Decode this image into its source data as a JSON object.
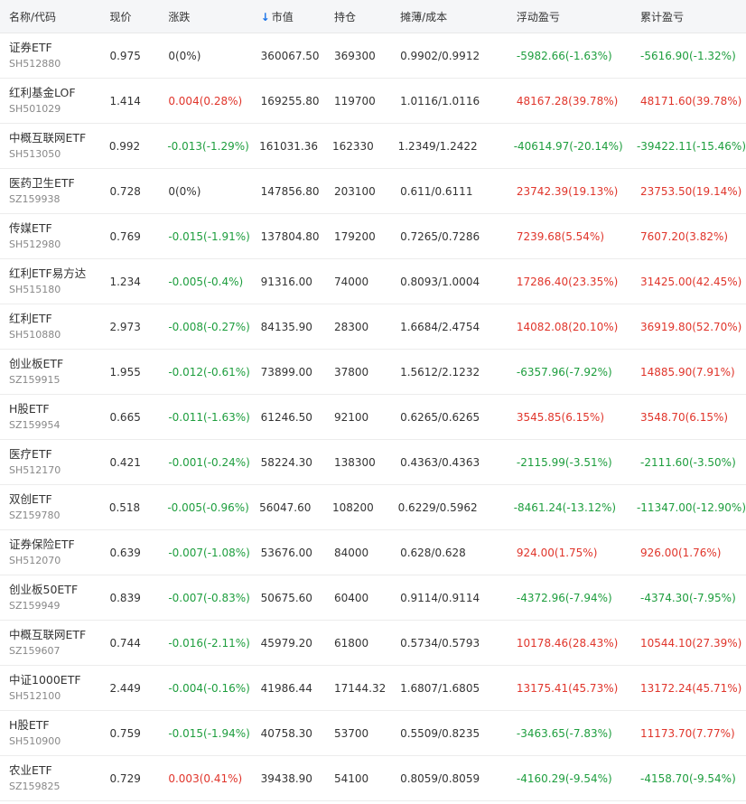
{
  "colors": {
    "up": "#e0352b",
    "down": "#1e9e3e",
    "sort_arrow": "#1a73e8"
  },
  "header": {
    "name": "名称/代码",
    "price": "现价",
    "change": "涨跌",
    "sort_arrow_icon": "arrow-down-icon",
    "value": "市值",
    "position": "持仓",
    "cost": "摊薄/成本",
    "float_pl": "浮动盈亏",
    "cum_pl": "累计盈亏"
  },
  "rows": [
    {
      "name": "证券ETF",
      "code": "SH512880",
      "price": "0.975",
      "change": "0(0%)",
      "change_dir": "flat",
      "value": "360067.50",
      "position": "369300",
      "cost": "0.9902/0.9912",
      "float_pl": "-5982.66(-1.63%)",
      "float_dir": "down",
      "cum_pl": "-5616.90(-1.32%)",
      "cum_dir": "down"
    },
    {
      "name": "红利基金LOF",
      "code": "SH501029",
      "price": "1.414",
      "change": "0.004(0.28%)",
      "change_dir": "up",
      "value": "169255.80",
      "position": "119700",
      "cost": "1.0116/1.0116",
      "float_pl": "48167.28(39.78%)",
      "float_dir": "up",
      "cum_pl": "48171.60(39.78%)",
      "cum_dir": "up"
    },
    {
      "name": "中概互联网ETF",
      "code": "SH513050",
      "price": "0.992",
      "change": "-0.013(-1.29%)",
      "change_dir": "down",
      "value": "161031.36",
      "position": "162330",
      "cost": "1.2349/1.2422",
      "float_pl": "-40614.97(-20.14%)",
      "float_dir": "down",
      "cum_pl": "-39422.11(-15.46%)",
      "cum_dir": "down"
    },
    {
      "name": "医药卫生ETF",
      "code": "SZ159938",
      "price": "0.728",
      "change": "0(0%)",
      "change_dir": "flat",
      "value": "147856.80",
      "position": "203100",
      "cost": "0.611/0.6111",
      "float_pl": "23742.39(19.13%)",
      "float_dir": "up",
      "cum_pl": "23753.50(19.14%)",
      "cum_dir": "up"
    },
    {
      "name": "传媒ETF",
      "code": "SH512980",
      "price": "0.769",
      "change": "-0.015(-1.91%)",
      "change_dir": "down",
      "value": "137804.80",
      "position": "179200",
      "cost": "0.7265/0.7286",
      "float_pl": "7239.68(5.54%)",
      "float_dir": "up",
      "cum_pl": "7607.20(3.82%)",
      "cum_dir": "up"
    },
    {
      "name": "红利ETF易方达",
      "code": "SH515180",
      "price": "1.234",
      "change": "-0.005(-0.4%)",
      "change_dir": "down",
      "value": "91316.00",
      "position": "74000",
      "cost": "0.8093/1.0004",
      "float_pl": "17286.40(23.35%)",
      "float_dir": "up",
      "cum_pl": "31425.00(42.45%)",
      "cum_dir": "up"
    },
    {
      "name": "红利ETF",
      "code": "SH510880",
      "price": "2.973",
      "change": "-0.008(-0.27%)",
      "change_dir": "down",
      "value": "84135.90",
      "position": "28300",
      "cost": "1.6684/2.4754",
      "float_pl": "14082.08(20.10%)",
      "float_dir": "up",
      "cum_pl": "36919.80(52.70%)",
      "cum_dir": "up"
    },
    {
      "name": "创业板ETF",
      "code": "SZ159915",
      "price": "1.955",
      "change": "-0.012(-0.61%)",
      "change_dir": "down",
      "value": "73899.00",
      "position": "37800",
      "cost": "1.5612/2.1232",
      "float_pl": "-6357.96(-7.92%)",
      "float_dir": "down",
      "cum_pl": "14885.90(7.91%)",
      "cum_dir": "up"
    },
    {
      "name": "H股ETF",
      "code": "SZ159954",
      "price": "0.665",
      "change": "-0.011(-1.63%)",
      "change_dir": "down",
      "value": "61246.50",
      "position": "92100",
      "cost": "0.6265/0.6265",
      "float_pl": "3545.85(6.15%)",
      "float_dir": "up",
      "cum_pl": "3548.70(6.15%)",
      "cum_dir": "up"
    },
    {
      "name": "医疗ETF",
      "code": "SH512170",
      "price": "0.421",
      "change": "-0.001(-0.24%)",
      "change_dir": "down",
      "value": "58224.30",
      "position": "138300",
      "cost": "0.4363/0.4363",
      "float_pl": "-2115.99(-3.51%)",
      "float_dir": "down",
      "cum_pl": "-2111.60(-3.50%)",
      "cum_dir": "down"
    },
    {
      "name": "双创ETF",
      "code": "SZ159780",
      "price": "0.518",
      "change": "-0.005(-0.96%)",
      "change_dir": "down",
      "value": "56047.60",
      "position": "108200",
      "cost": "0.6229/0.5962",
      "float_pl": "-8461.24(-13.12%)",
      "float_dir": "down",
      "cum_pl": "-11347.00(-12.90%)",
      "cum_dir": "down"
    },
    {
      "name": "证券保险ETF",
      "code": "SH512070",
      "price": "0.639",
      "change": "-0.007(-1.08%)",
      "change_dir": "down",
      "value": "53676.00",
      "position": "84000",
      "cost": "0.628/0.628",
      "float_pl": "924.00(1.75%)",
      "float_dir": "up",
      "cum_pl": "926.00(1.76%)",
      "cum_dir": "up"
    },
    {
      "name": "创业板50ETF",
      "code": "SZ159949",
      "price": "0.839",
      "change": "-0.007(-0.83%)",
      "change_dir": "down",
      "value": "50675.60",
      "position": "60400",
      "cost": "0.9114/0.9114",
      "float_pl": "-4372.96(-7.94%)",
      "float_dir": "down",
      "cum_pl": "-4374.30(-7.95%)",
      "cum_dir": "down"
    },
    {
      "name": "中概互联网ETF",
      "code": "SZ159607",
      "price": "0.744",
      "change": "-0.016(-2.11%)",
      "change_dir": "down",
      "value": "45979.20",
      "position": "61800",
      "cost": "0.5734/0.5793",
      "float_pl": "10178.46(28.43%)",
      "float_dir": "up",
      "cum_pl": "10544.10(27.39%)",
      "cum_dir": "up"
    },
    {
      "name": "中证1000ETF",
      "code": "SH512100",
      "price": "2.449",
      "change": "-0.004(-0.16%)",
      "change_dir": "down",
      "value": "41986.44",
      "position": "17144.32",
      "cost": "1.6807/1.6805",
      "float_pl": "13175.41(45.73%)",
      "float_dir": "up",
      "cum_pl": "13172.24(45.71%)",
      "cum_dir": "up"
    },
    {
      "name": "H股ETF",
      "code": "SH510900",
      "price": "0.759",
      "change": "-0.015(-1.94%)",
      "change_dir": "down",
      "value": "40758.30",
      "position": "53700",
      "cost": "0.5509/0.8235",
      "float_pl": "-3463.65(-7.83%)",
      "float_dir": "down",
      "cum_pl": "11173.70(7.77%)",
      "cum_dir": "up"
    },
    {
      "name": "农业ETF",
      "code": "SZ159825",
      "price": "0.729",
      "change": "0.003(0.41%)",
      "change_dir": "up",
      "value": "39438.90",
      "position": "54100",
      "cost": "0.8059/0.8059",
      "float_pl": "-4160.29(-9.54%)",
      "float_dir": "down",
      "cum_pl": "-4158.70(-9.54%)",
      "cum_dir": "down"
    }
  ]
}
